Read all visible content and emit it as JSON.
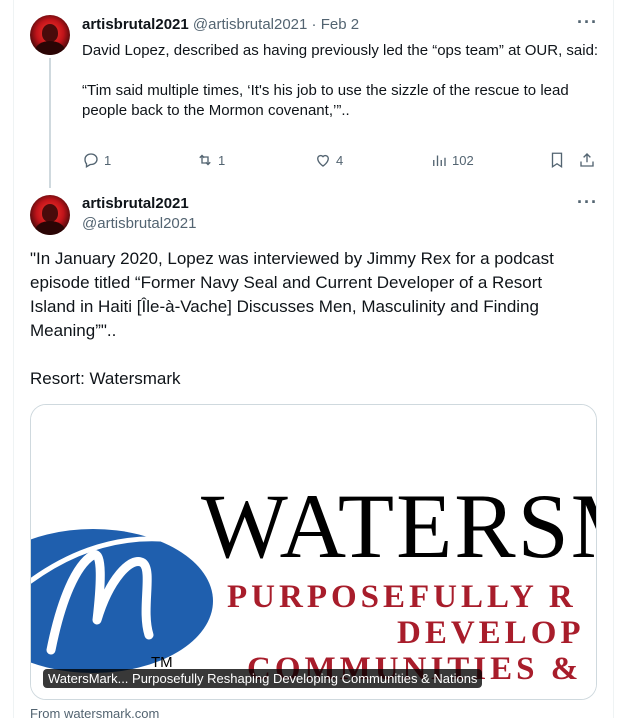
{
  "tweet1": {
    "display_name": "artisbrutal2021",
    "handle_date": "@artisbrutal2021 · Feb 2",
    "paragraphs": [
      "David Lopez, described as having previously led the “ops team” at OUR, said:",
      "“Tim said multiple times, ‘It's his job to use the sizzle of the rescue to lead people back to the Mormon covenant,’”.."
    ],
    "actions": {
      "reply_count": "1",
      "retweet_count": "1",
      "like_count": "4",
      "view_count": "102"
    }
  },
  "tweet2": {
    "display_name": "artisbrutal2021",
    "handle": "@artisbrutal2021",
    "paragraphs": [
      "\"In January 2020, Lopez was interviewed by Jimmy Rex for a podcast episode titled “Former Navy Seal and Current Developer of a Resort Island in Haiti [Île-à-Vache] Discusses Men, Masculinity and Finding Meaning”\"..",
      "Resort: Watersmark"
    ],
    "card": {
      "logo_word": "WATERSM",
      "tagline_lines": [
        "PURPOSEFULLY R",
        "DEVELOP",
        "COMMUNITIES &"
      ],
      "trademark": "TM",
      "caption": "WatersMark... Purposefully Reshaping Developing Communities & Nations",
      "source": "From watersmark.com"
    }
  },
  "icons": {
    "more": "more-horizontal-icon",
    "reply": "reply-icon",
    "retweet": "retweet-icon",
    "like": "heart-icon",
    "views": "views-icon",
    "bookmark": "bookmark-icon",
    "share": "share-icon"
  },
  "colors": {
    "text": "#0f1419",
    "secondary": "#536471",
    "logo_blue": "#1f5fae",
    "logo_red": "#a81d2b",
    "logo_black": "#000000"
  }
}
